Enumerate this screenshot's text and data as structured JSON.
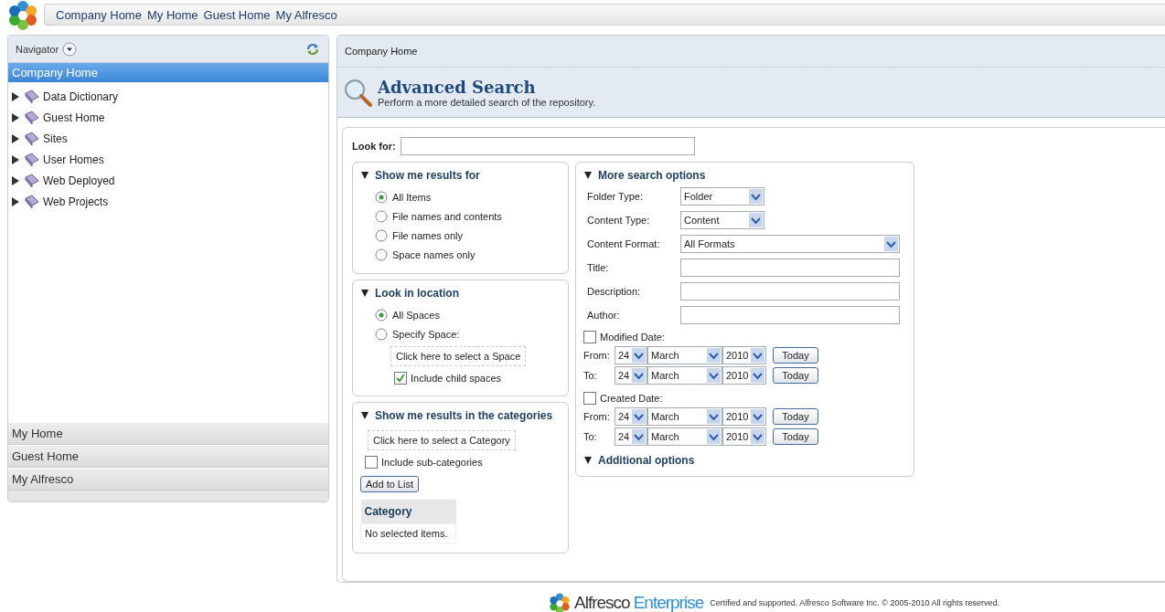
{
  "header": {
    "links": [
      "Company Home",
      "My Home",
      "Guest Home",
      "My Alfresco"
    ]
  },
  "navigator": {
    "title": "Navigator",
    "root": "Company Home",
    "tree": [
      {
        "label": "Data Dictionary",
        "expanded": false
      },
      {
        "label": "Guest Home",
        "expanded": false
      },
      {
        "label": "Sites",
        "expanded": false
      },
      {
        "label": "User Homes",
        "expanded": false
      },
      {
        "label": "Web Deployed",
        "expanded": false
      },
      {
        "label": "Web Projects",
        "expanded": false
      }
    ],
    "sections": [
      "My Home",
      "Guest Home",
      "My Alfresco"
    ]
  },
  "breadcrumb": "Company Home",
  "page_header": {
    "title": "Advanced Search",
    "subtitle": "Perform a more detailed search of the repository."
  },
  "look_for": {
    "label": "Look for:"
  },
  "results_for": {
    "title": "Show me results for",
    "options": [
      {
        "label": "All Items",
        "selected": true
      },
      {
        "label": "File names and contents",
        "selected": false
      },
      {
        "label": "File names only",
        "selected": false
      },
      {
        "label": "Space names only",
        "selected": false
      }
    ]
  },
  "location": {
    "title": "Look in location",
    "options": [
      {
        "label": "All Spaces",
        "selected": true
      },
      {
        "label": "Specify Space:",
        "selected": false
      }
    ],
    "picker": "Click here to select a Space",
    "include_children": {
      "label": "Include child spaces",
      "checked": true
    }
  },
  "categories": {
    "title": "Show me results in the categories",
    "picker": "Click here to select a Category",
    "include_sub": {
      "label": "Include sub-categories",
      "checked": false
    },
    "add_button": "Add to List",
    "table": {
      "column": "Category",
      "empty": "No selected items."
    }
  },
  "more_options": {
    "title": "More search options",
    "selects": [
      {
        "label": "Folder Type:",
        "value": "Folder",
        "kind": "short"
      },
      {
        "label": "Content Type:",
        "value": "Content",
        "kind": "short"
      },
      {
        "label": "Content Format:",
        "value": "All Formats",
        "kind": "wide"
      }
    ],
    "fields": [
      {
        "label": "Title:"
      },
      {
        "label": "Description:"
      },
      {
        "label": "Author:"
      }
    ],
    "date_groups": [
      {
        "label": "Modified Date:",
        "checked": false,
        "rows": [
          {
            "label": "From:",
            "day": "24",
            "month": "March",
            "year": "2010",
            "button": "Today"
          },
          {
            "label": "To:",
            "day": "24",
            "month": "March",
            "year": "2010",
            "button": "Today"
          }
        ]
      },
      {
        "label": "Created Date:",
        "checked": false,
        "rows": [
          {
            "label": "From:",
            "day": "24",
            "month": "March",
            "year": "2010",
            "button": "Today"
          },
          {
            "label": "To:",
            "day": "24",
            "month": "March",
            "year": "2010",
            "button": "Today"
          }
        ]
      }
    ]
  },
  "additional": {
    "title": "Additional options"
  },
  "footer": {
    "brand": "Alfresco",
    "edition": "Enterprise",
    "notice": "Certified and supported. Alfresco Software Inc. © 2005-2010 All rights reserved."
  }
}
